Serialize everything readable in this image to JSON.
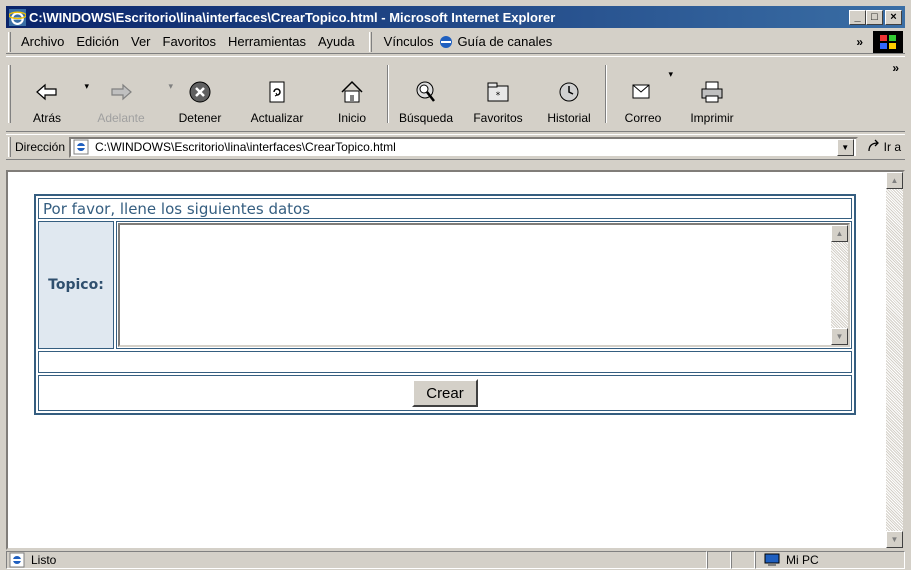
{
  "window": {
    "title": "C:\\WINDOWS\\Escritorio\\lina\\interfaces\\CrearTopico.html - Microsoft Internet Explorer",
    "minimize_glyph": "_",
    "maximize_glyph": "□",
    "close_glyph": "×"
  },
  "menu": {
    "items": [
      {
        "label": "Archivo",
        "accel": "A"
      },
      {
        "label": "Edición",
        "accel": "E"
      },
      {
        "label": "Ver",
        "accel": "V"
      },
      {
        "label": "Favoritos",
        "accel": "F"
      },
      {
        "label": "Herramientas",
        "accel": "H"
      },
      {
        "label": "Ayuda",
        "accel": "u"
      }
    ],
    "links_label": "Vínculos",
    "channel_guide": "Guía de canales",
    "more": "»"
  },
  "toolbar": {
    "back": "Atrás",
    "forward": "Adelante",
    "stop": "Detener",
    "refresh": "Actualizar",
    "home": "Inicio",
    "search": "Búsqueda",
    "favorites": "Favoritos",
    "history": "Historial",
    "mail": "Correo",
    "print": "Imprimir",
    "more": "»"
  },
  "address": {
    "label": "Dirección",
    "url": "C:\\WINDOWS\\Escritorio\\lina\\interfaces\\CrearTopico.html",
    "go": "Ir a"
  },
  "page": {
    "heading": "Por favor, llene los siguientes datos",
    "topic_label": "Topico:",
    "topic_value": "",
    "submit": "Crear"
  },
  "status": {
    "text": "Listo",
    "zone": "Mi PC"
  },
  "colors": {
    "title_bar": "#0a246a",
    "form_border": "#355e80",
    "label_bg": "#e0e8f0",
    "chrome": "#d4d0c8"
  }
}
